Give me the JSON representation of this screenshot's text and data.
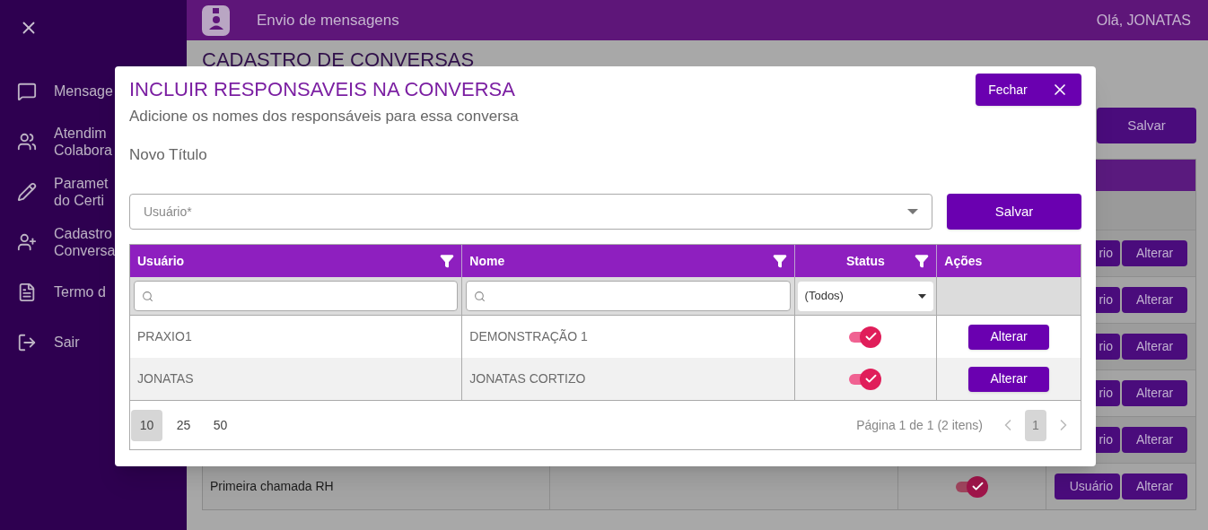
{
  "sidebar": {
    "items": [
      {
        "lines": [
          "Mensage"
        ]
      },
      {
        "lines": [
          "Atendim",
          "Colabora"
        ]
      },
      {
        "lines": [
          "Paramet",
          "do Certi"
        ]
      },
      {
        "lines": [
          "Cadastro",
          "Conversa"
        ]
      },
      {
        "lines": [
          "Termo d"
        ]
      },
      {
        "lines": [
          "Sair"
        ]
      }
    ]
  },
  "header": {
    "title": "Envio de mensagens",
    "greeting": "Olá, JONATAS"
  },
  "page": {
    "title": "CADASTRO DE CONVERSAS",
    "save_button": "Salvar",
    "rows": [
      {
        "user_button": "rio",
        "edit_button": "Alterar"
      },
      {
        "user_button": "rio",
        "edit_button": "Alterar"
      },
      {
        "user_button": "rio",
        "edit_button": "Alterar"
      },
      {
        "user_button": "rio",
        "edit_button": "Alterar"
      },
      {
        "user_button": "rio",
        "edit_button": "Alterar"
      },
      {
        "name": "Primeira chamada RH",
        "active": true,
        "user_button": "Usuário",
        "edit_button": "Alterar"
      }
    ]
  },
  "modal": {
    "title": "INCLUIR RESPONSAVEIS NA CONVERSA",
    "subtitle": "Adicione os nomes dos responsáveis para essa conversa",
    "conversation_title": "Novo Título",
    "close_button": "Fechar",
    "user_select": {
      "placeholder": "Usuário*"
    },
    "save_button": "Salvar",
    "columns": [
      {
        "label": "Usuário",
        "filter": true
      },
      {
        "label": "Nome",
        "filter": true
      },
      {
        "label": "Status",
        "filter": true
      },
      {
        "label": "Ações",
        "filter": false
      }
    ],
    "status_filter": "(Todos)",
    "rows": [
      {
        "user": "PRAXIO1",
        "name": "DEMONSTRAÇÃO 1",
        "active": true,
        "action": "Alterar"
      },
      {
        "user": "JONATAS",
        "name": "JONATAS CORTIZO",
        "active": true,
        "action": "Alterar"
      }
    ],
    "page_sizes": [
      {
        "label": "10",
        "selected": true
      },
      {
        "label": "25",
        "selected": false
      },
      {
        "label": "50",
        "selected": false
      }
    ],
    "page_info": "Página 1 de 1 (2 itens)",
    "pages": [
      {
        "label": "1",
        "selected": true
      }
    ]
  }
}
